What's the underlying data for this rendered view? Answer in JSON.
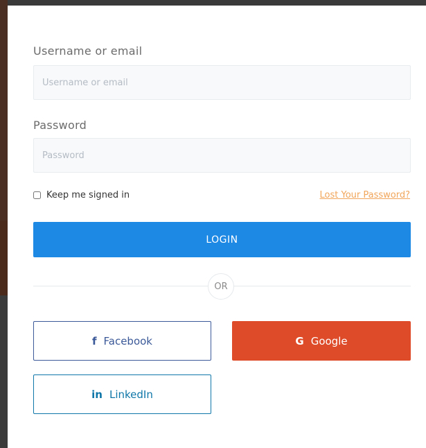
{
  "form": {
    "username_label": "Username or email",
    "username_placeholder": "Username or email",
    "password_label": "Password",
    "password_placeholder": "Password",
    "remember_label": "Keep me signed in",
    "lost_password_link": "Lost Your Password?",
    "login_button": "LOGIN",
    "separator": "OR"
  },
  "social": {
    "facebook": {
      "label": "Facebook",
      "icon": "f",
      "color": "#3b5998"
    },
    "google": {
      "label": "Google",
      "icon": "G",
      "color": "#dd4b29"
    },
    "linkedin": {
      "label": "LinkedIn",
      "icon": "in",
      "color": "#0e76a8"
    }
  },
  "colors": {
    "primary": "#1e88e5",
    "link": "#f1a55a"
  }
}
